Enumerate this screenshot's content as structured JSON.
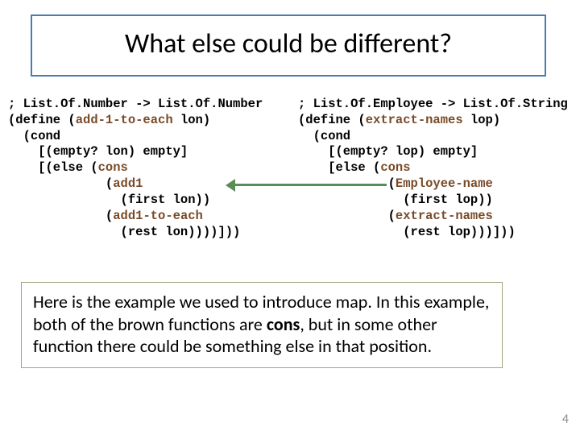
{
  "title": "What else could be different?",
  "code": {
    "left": {
      "l1": "; List.Of.Number -> List.Of.Number",
      "l2a": "(define (",
      "l2b": "add-1-to-each",
      "l2c": " lon)",
      "l3": "  (cond",
      "l4": "    [(empty? lon) empty]",
      "l5a": "    [(else (",
      "l5b": "cons",
      "l6a": "             (",
      "l6b": "add1",
      "l7": "               (first lon))",
      "l8a": "             (",
      "l8b": "add1-to-each",
      "l9": "               (rest lon))))]))"
    },
    "right": {
      "l1": "; List.Of.Employee -> List.Of.String",
      "l2a": "(define (",
      "l2b": "extract-names",
      "l2c": " lop)",
      "l3": "  (cond",
      "l4": "    [(empty? lop) empty]",
      "l5a": "    [else (",
      "l5b": "cons",
      "l6a": "            (",
      "l6b": "Employee-name",
      "l7": "              (first lop))",
      "l8a": "            (",
      "l8b": "extract-names",
      "l9": "              (rest lop)))]))"
    }
  },
  "note": {
    "p1": "Here is the example we used to introduce map.  In this example, both of the brown functions are ",
    "p2": "cons",
    "p3": ", but in some other function there could be something else in that position."
  },
  "page": "4"
}
